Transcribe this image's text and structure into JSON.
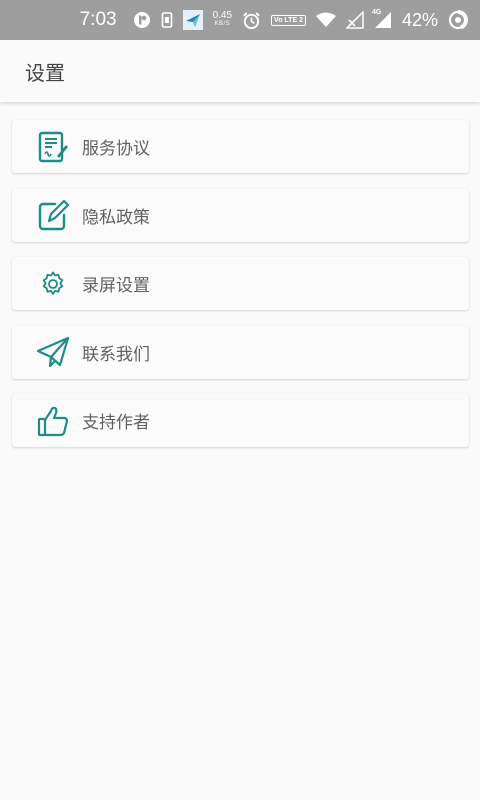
{
  "status_bar": {
    "time": "7:03",
    "net_speed_value": "0.45",
    "net_speed_unit": "KB/S",
    "volte_text": "Vo LTE 2",
    "signal_type": "4G",
    "battery_percent": "42%",
    "icons": [
      "notification-app-icon",
      "sim-icon",
      "app-notification-icon",
      "alarm-icon",
      "volte-icon",
      "wifi-icon",
      "no-signal-icon",
      "signal-4g-icon",
      "battery-icon"
    ]
  },
  "app_bar": {
    "title": "设置"
  },
  "menu": {
    "items": [
      {
        "label": "服务协议",
        "icon": "document-sign-icon"
      },
      {
        "label": "隐私政策",
        "icon": "edit-icon"
      },
      {
        "label": "录屏设置",
        "icon": "gear-icon"
      },
      {
        "label": "联系我们",
        "icon": "paper-plane-icon"
      },
      {
        "label": "支持作者",
        "icon": "thumbs-up-icon"
      }
    ]
  },
  "colors": {
    "accent": "#1e8c87",
    "status_bar": "#9e9e9e",
    "background": "#fafafa",
    "text": "#616161"
  }
}
